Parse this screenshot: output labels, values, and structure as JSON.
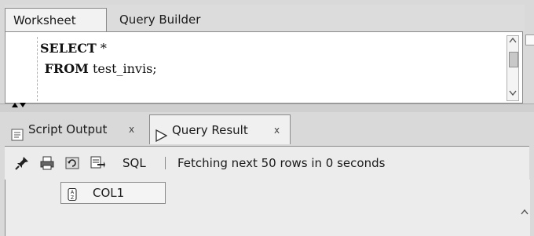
{
  "editor_tabs": [
    {
      "label": "Worksheet",
      "active": true
    },
    {
      "label": "Query Builder",
      "active": false
    }
  ],
  "editor": {
    "lines": [
      {
        "keyword": "SELECT",
        "rest": " *"
      },
      {
        "keyword": " FROM",
        "rest": " test_invis;"
      }
    ]
  },
  "result_tabs": [
    {
      "label": "Script Output",
      "close": "x",
      "icon": "script-output-icon"
    },
    {
      "label": "Query Result",
      "close": "x",
      "icon": "run-triangle-icon",
      "active": true
    }
  ],
  "toolbar": {
    "icons": [
      "pin-icon",
      "print-icon",
      "refresh-icon",
      "export-icon"
    ],
    "sql_label": "SQL",
    "separator": "|",
    "status": "Fetching next 50 rows in 0 seconds"
  },
  "grid": {
    "columns": [
      {
        "label": "COL1",
        "icon": "sort-az-icon"
      }
    ],
    "rows": []
  }
}
